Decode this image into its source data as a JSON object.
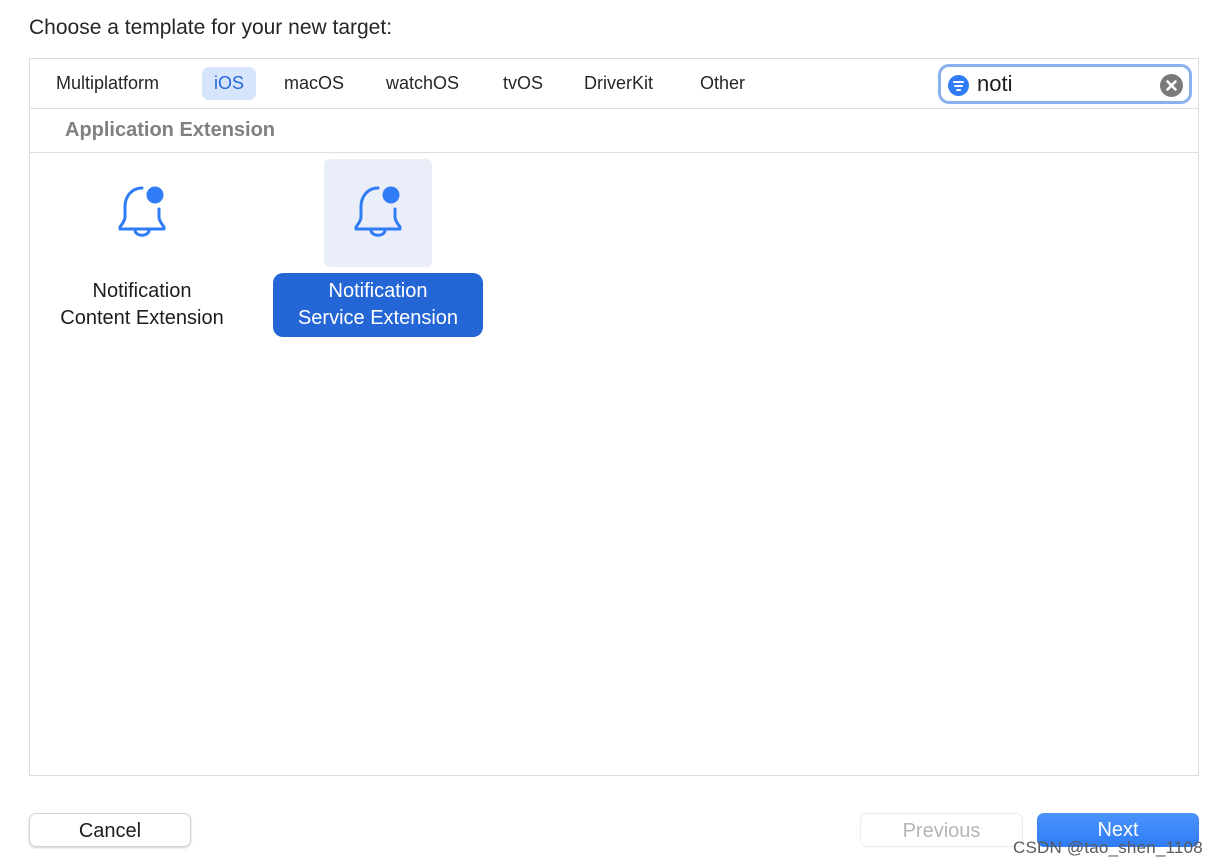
{
  "dialog": {
    "title": "Choose a template for your new target:"
  },
  "tabs": [
    {
      "label": "Multiplatform",
      "active": false
    },
    {
      "label": "iOS",
      "active": true
    },
    {
      "label": "macOS",
      "active": false
    },
    {
      "label": "watchOS",
      "active": false
    },
    {
      "label": "tvOS",
      "active": false
    },
    {
      "label": "DriverKit",
      "active": false
    },
    {
      "label": "Other",
      "active": false
    }
  ],
  "search": {
    "value": "noti",
    "icon": "filter-icon",
    "clear_icon": "clear-icon"
  },
  "section": {
    "title": "Application Extension"
  },
  "templates": [
    {
      "label": "Notification Content Extension",
      "line1": "Notification",
      "line2": "Content Extension",
      "icon": "bell-badge-icon",
      "selected": false
    },
    {
      "label": "Notification Service Extension",
      "line1": "Notification",
      "line2": "Service Extension",
      "icon": "bell-badge-icon",
      "selected": true
    }
  ],
  "buttons": {
    "cancel": "Cancel",
    "previous": "Previous",
    "next": "Next"
  },
  "watermark": "CSDN @tao_shen_1108",
  "colors": {
    "accent": "#2466d6",
    "icon": "#2f7cf6",
    "tab_active_bg": "#d6e5fb"
  }
}
